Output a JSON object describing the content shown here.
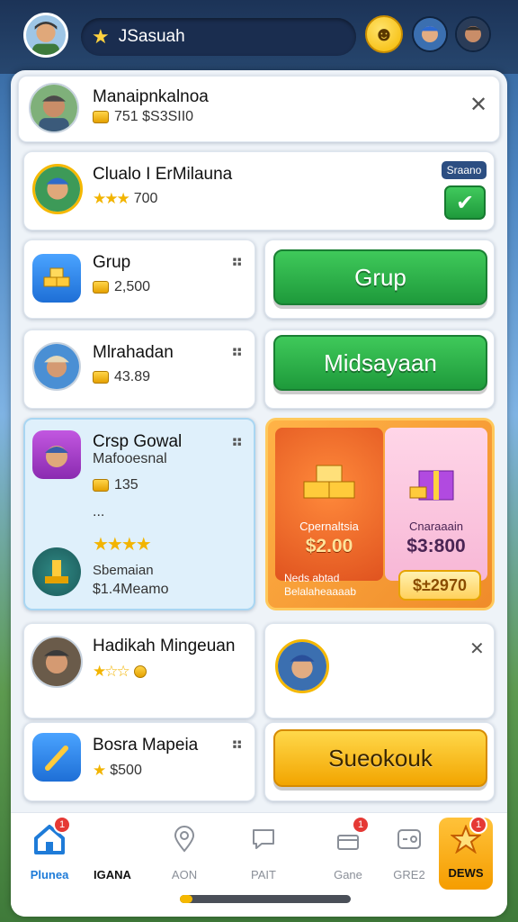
{
  "header": {
    "player_name": "JSasuah",
    "emoji_label": "☻"
  },
  "rows": [
    {
      "title": "Manaipnkalnoa",
      "sub": "751 $S3SII0"
    },
    {
      "title": "Clualo I ErMilauna",
      "sub": "700",
      "badge": "Sraano"
    },
    {
      "title": "Grup",
      "sub": "2,500",
      "button": "Grup"
    },
    {
      "title": "Mlrahadan",
      "sub": "43.89",
      "button": "Midsayaan"
    },
    {
      "title": "Crsp Gowal",
      "subtitle": "Mafooesnal",
      "sub": "135",
      "dots_text": "...",
      "footer_title": "Sbemaian",
      "footer_value": "$1.4Meamo"
    },
    {
      "title": "Hadikah Mingeuan"
    },
    {
      "title": "Bosra Mapeia",
      "sub": "$500",
      "button": "Sueokouk"
    }
  ],
  "promo": {
    "left_label": "Cpernaltsia",
    "left_price": "$2.00",
    "right_label": "Cnaraaain",
    "right_price": "$3:800",
    "note": "Neds abtad Belalaheaaaab",
    "buy_label": "$±2970"
  },
  "nav": [
    {
      "label": "Plunea",
      "icon": "home-icon",
      "badge": "1",
      "active": true
    },
    {
      "label": "IGANA",
      "icon": "",
      "badge": ""
    },
    {
      "label": "AON",
      "icon": "location-icon",
      "badge": ""
    },
    {
      "label": "PAIT",
      "icon": "chat-icon",
      "badge": ""
    },
    {
      "label": "Gane",
      "icon": "gift-box-icon",
      "badge": "1"
    },
    {
      "label": "GRE2",
      "icon": "gamepad-icon",
      "badge": ""
    },
    {
      "label": "DEWS",
      "icon": "star-icon",
      "badge": "1",
      "highlight": true
    }
  ],
  "colors": {
    "accent_green": "#22a843",
    "accent_yellow": "#f5b800",
    "nav_active": "#1e7bd8"
  }
}
